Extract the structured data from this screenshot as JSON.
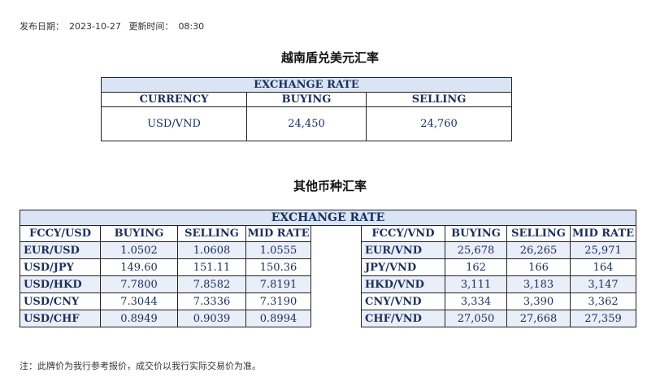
{
  "meta": {
    "publish_label": "发布日期：",
    "publish_date": "2023-10-27",
    "update_label": "更新时间：",
    "update_time": "08:30"
  },
  "usd_vnd": {
    "title": "越南盾兑美元汇率",
    "header": "EXCHANGE RATE",
    "columns": [
      "CURRENCY",
      "BUYING",
      "SELLING"
    ],
    "row": {
      "currency": "USD/VND",
      "buying": "24,450",
      "selling": "24,760"
    }
  },
  "others": {
    "title": "其他币种汇率",
    "header": "EXCHANGE  RATE",
    "left_columns": [
      "FCCY/USD",
      "BUYING",
      "SELLING",
      "MID RATE"
    ],
    "right_columns": [
      "FCCY/VND",
      "BUYING",
      "SELLING",
      "MID RATE"
    ],
    "left_rows": [
      {
        "pair": "EUR/USD",
        "buying": "1.0502",
        "selling": "1.0608",
        "mid": "1.0555"
      },
      {
        "pair": "USD/JPY",
        "buying": "149.60",
        "selling": "151.11",
        "mid": "150.36"
      },
      {
        "pair": "USD/HKD",
        "buying": "7.7800",
        "selling": "7.8582",
        "mid": "7.8191"
      },
      {
        "pair": "USD/CNY",
        "buying": "7.3044",
        "selling": "7.3336",
        "mid": "7.3190"
      },
      {
        "pair": "USD/CHF",
        "buying": "0.8949",
        "selling": "0.9039",
        "mid": "0.8994"
      }
    ],
    "right_rows": [
      {
        "pair": "EUR/VND",
        "buying": "25,678",
        "selling": "26,265",
        "mid": "25,971"
      },
      {
        "pair": "JPY/VND",
        "buying": "162",
        "selling": "166",
        "mid": "164"
      },
      {
        "pair": "HKD/VND",
        "buying": "3,111",
        "selling": "3,183",
        "mid": "3,147"
      },
      {
        "pair": "CNY/VND",
        "buying": "3,334",
        "selling": "3,390",
        "mid": "3,362"
      },
      {
        "pair": "CHF/VND",
        "buying": "27,050",
        "selling": "27,668",
        "mid": "27,359"
      }
    ]
  },
  "note": "注：此牌价为我行参考报价，成交价以我行实际交易价为准。"
}
